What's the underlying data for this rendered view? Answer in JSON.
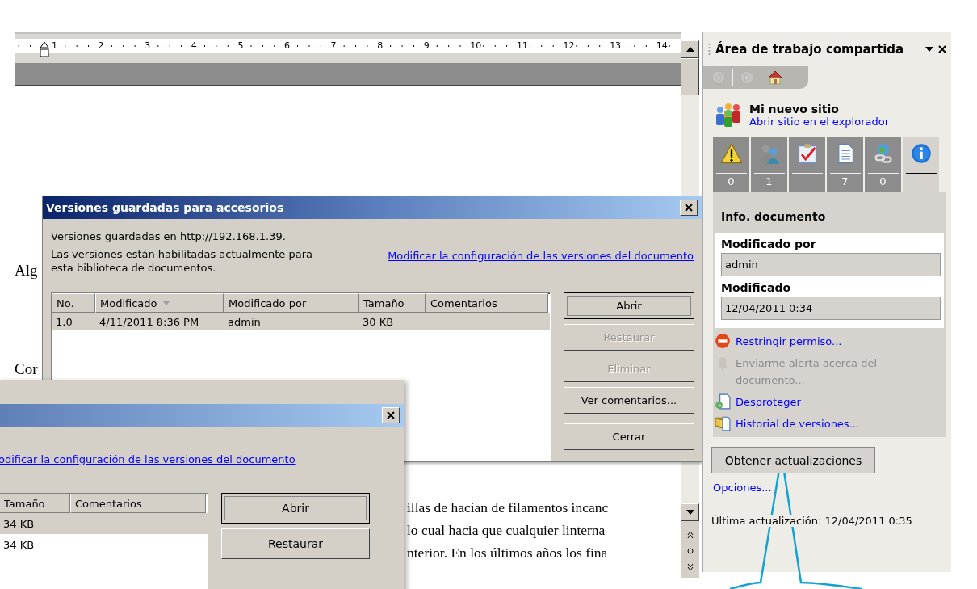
{
  "ruler": {
    "labels": [
      "1",
      "2",
      "3",
      "4",
      "5",
      "6",
      "7",
      "8",
      "9",
      "10",
      "11",
      "12",
      "13",
      "14"
    ]
  },
  "document": {
    "fragments": [
      "Alg",
      "Cor"
    ],
    "lines": [
      "illas de hacían de filamentos incanc",
      "lo cual hacia que cualquier linterna",
      "nterior. En los últimos años los fina"
    ]
  },
  "dialogs": [
    {
      "title": "Versiones guardadas para accesorios",
      "location": "Versiones guardadas en http://192.168.1.39.",
      "status_text": "Las versiones están habilitadas actualmente para esta biblioteca de documentos.",
      "link": "Modificar la configuración de las versiones del documento",
      "columns": [
        {
          "label": "No.",
          "sorted": false
        },
        {
          "label": "Modificado",
          "sorted": true
        },
        {
          "label": "Modificado por",
          "sorted": false
        },
        {
          "label": "Tamaño",
          "sorted": false
        },
        {
          "label": "Comentarios",
          "sorted": false
        }
      ],
      "rows": [
        {
          "cells": [
            "1.0",
            "4/11/2011 8:36 PM",
            "admin",
            "30 KB",
            ""
          ],
          "selected": true
        }
      ],
      "buttons": [
        {
          "label": "Abrir",
          "disabled": false,
          "default": true
        },
        {
          "label": "Restaurar",
          "disabled": true,
          "default": false
        },
        {
          "label": "Eliminar",
          "disabled": true,
          "default": false
        },
        {
          "label": "Ver comentarios...",
          "disabled": false,
          "default": false
        },
        {
          "label": "Cerrar",
          "disabled": false,
          "default": false
        }
      ]
    },
    {
      "link": "odificar la configuración de las versiones del documento",
      "columns": [
        {
          "label": "Tamaño",
          "sorted": false
        },
        {
          "label": "Comentarios",
          "sorted": false
        }
      ],
      "rows": [
        {
          "cells": [
            "34 KB",
            ""
          ],
          "selected": true
        },
        {
          "cells": [
            "34 KB",
            ""
          ],
          "selected": false
        }
      ],
      "buttons": [
        {
          "label": "Abrir",
          "disabled": false,
          "default": true
        },
        {
          "label": "Restaurar",
          "disabled": false,
          "default": false
        }
      ]
    }
  ],
  "task_pane": {
    "title": "Área de trabajo compartida",
    "nav": [
      {
        "kind": "back",
        "disabled": true
      },
      {
        "kind": "forward",
        "disabled": true
      },
      {
        "kind": "home",
        "disabled": false
      }
    ],
    "site": {
      "name": "Mi nuevo sitio",
      "link": "Abrir sitio en el explorador"
    },
    "tabs": [
      {
        "kind": "alert",
        "count": "0",
        "selected": false
      },
      {
        "kind": "members",
        "count": "1",
        "selected": false
      },
      {
        "kind": "tasks",
        "selected": false
      },
      {
        "kind": "documents",
        "count": "7",
        "selected": false
      },
      {
        "kind": "links",
        "count": "0",
        "selected": false
      },
      {
        "kind": "info",
        "selected": true
      }
    ],
    "section_title": "Info. documento",
    "fields": [
      {
        "label": "Modificado por",
        "value": "admin"
      },
      {
        "label": "Modificado",
        "value": "12/04/2011 0:34"
      }
    ],
    "actions": [
      {
        "kind": "restrict",
        "label": "Restringir permiso...",
        "disabled": false
      },
      {
        "kind": "alert",
        "label": "Enviarme alerta acerca del documento...",
        "disabled": true
      },
      {
        "kind": "checkin",
        "label": "Desproteger",
        "disabled": false
      },
      {
        "kind": "history",
        "label": "Historial de versiones...",
        "disabled": false
      }
    ],
    "update_button": "Obtener actualizaciones",
    "options_link": "Opciones...",
    "last_update": "Última actualización: 12/04/2011 0:35"
  }
}
